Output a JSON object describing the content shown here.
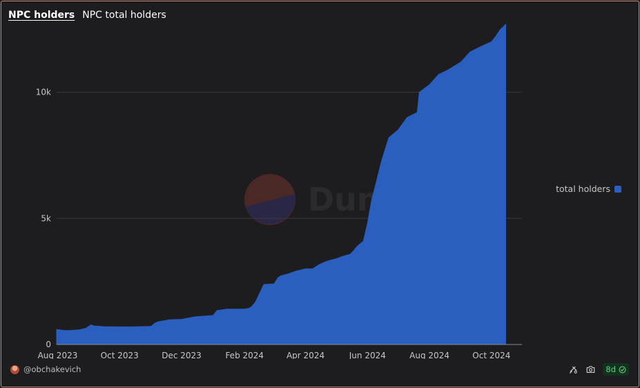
{
  "header": {
    "title": "NPC holders",
    "subtitle": "NPC total holders"
  },
  "footer": {
    "author": "@obchakevich",
    "badge": "8d"
  },
  "watermark": "Dune",
  "colors": {
    "background": "#1d1d1f",
    "area": "#2b5fbf",
    "grid": "#3a3a3c",
    "accent_border": "#c98a7c",
    "badge_text": "#5fd07f"
  },
  "icons": [
    "refresh-icon",
    "camera-icon",
    "check-circle-icon"
  ],
  "chart_data": {
    "type": "area",
    "title": "",
    "xlabel": "",
    "ylabel": "",
    "ylim": [
      0,
      13000
    ],
    "xlim": [
      "2023-07-31",
      "2024-10-31"
    ],
    "yticks": [
      0,
      5000,
      10000
    ],
    "ytick_labels": [
      "0",
      "5k",
      "10k"
    ],
    "xticks": [
      "2023-08-01",
      "2023-10-01",
      "2023-12-01",
      "2024-02-01",
      "2024-04-01",
      "2024-06-01",
      "2024-08-01",
      "2024-10-01"
    ],
    "xtick_labels": [
      "Aug 2023",
      "Oct 2023",
      "Dec 2023",
      "Feb 2024",
      "Apr 2024",
      "Jun 2024",
      "Aug 2024",
      "Oct 2024"
    ],
    "grid": true,
    "legend_position": "right",
    "series": [
      {
        "name": "total holders",
        "color": "#2b5fbf",
        "x": [
          "2023-07-31",
          "2023-08-08",
          "2023-08-15",
          "2023-08-22",
          "2023-08-29",
          "2023-09-03",
          "2023-09-05",
          "2023-09-15",
          "2023-10-01",
          "2023-10-15",
          "2023-11-01",
          "2023-11-05",
          "2023-11-08",
          "2023-11-15",
          "2023-11-18",
          "2023-12-01",
          "2023-12-08",
          "2023-12-15",
          "2024-01-01",
          "2024-01-05",
          "2024-01-15",
          "2024-02-01",
          "2024-02-05",
          "2024-02-08",
          "2024-02-12",
          "2024-02-20",
          "2024-03-01",
          "2024-03-05",
          "2024-03-08",
          "2024-03-15",
          "2024-03-22",
          "2024-04-01",
          "2024-04-08",
          "2024-04-15",
          "2024-04-22",
          "2024-05-01",
          "2024-05-08",
          "2024-05-15",
          "2024-05-18",
          "2024-05-22",
          "2024-05-28",
          "2024-06-01",
          "2024-06-05",
          "2024-06-10",
          "2024-06-15",
          "2024-06-22",
          "2024-07-01",
          "2024-07-10",
          "2024-07-20",
          "2024-07-22",
          "2024-08-01",
          "2024-08-10",
          "2024-08-20",
          "2024-09-01",
          "2024-09-10",
          "2024-09-20",
          "2024-09-28",
          "2024-10-01",
          "2024-10-05",
          "2024-10-10",
          "2024-10-13",
          "2024-10-15"
        ],
        "y": [
          600,
          550,
          560,
          580,
          650,
          780,
          740,
          710,
          700,
          700,
          720,
          850,
          900,
          950,
          980,
          1000,
          1050,
          1100,
          1150,
          1350,
          1400,
          1400,
          1430,
          1500,
          1700,
          2380,
          2400,
          2650,
          2730,
          2800,
          2900,
          3000,
          3000,
          3180,
          3300,
          3400,
          3500,
          3580,
          3700,
          3900,
          4100,
          4800,
          5700,
          6500,
          7300,
          8200,
          8500,
          9000,
          9200,
          10000,
          10300,
          10700,
          10900,
          11200,
          11600,
          11800,
          11950,
          12000,
          12200,
          12500,
          12600,
          12700
        ]
      }
    ]
  }
}
